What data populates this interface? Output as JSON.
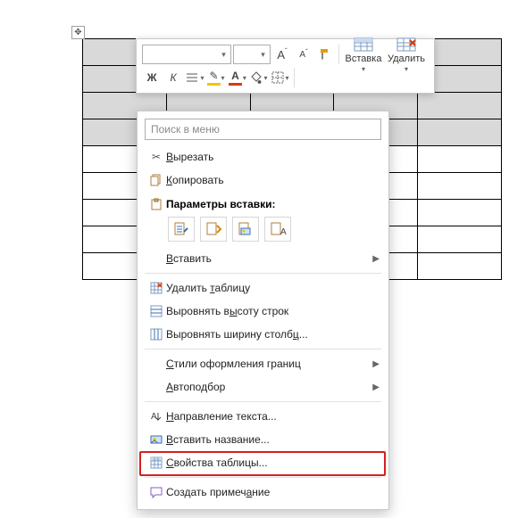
{
  "toolbar": {
    "font_name": "",
    "font_size": "",
    "increase_font_tt": "A▲",
    "decrease_font_tt": "A▼",
    "bold": "Ж",
    "italic": "К",
    "insert_label": "Вставка",
    "delete_label": "Удалить"
  },
  "context_menu": {
    "search_placeholder": "Поиск в меню",
    "cut": "Вырезать",
    "copy": "Копировать",
    "paste_options_title": "Параметры вставки:",
    "paste": "Вставить",
    "delete_table": "Удалить таблицу",
    "distribute_rows": "Выровнять высоту строк",
    "distribute_cols": "Выровнять ширину столбц...",
    "border_styles": "Стили оформления границ",
    "autofit": "Автоподбор",
    "text_direction": "Направление текста...",
    "insert_caption": "Вставить название...",
    "table_properties": "Свойства таблицы...",
    "new_comment": "Создать примечание"
  }
}
